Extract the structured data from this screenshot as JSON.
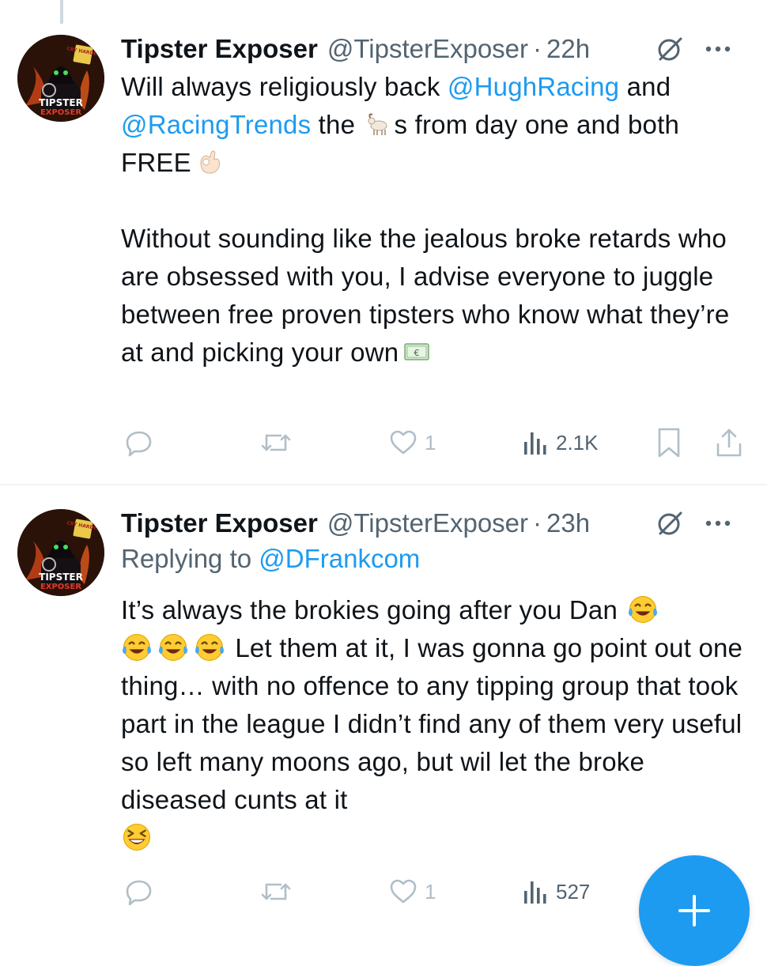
{
  "tweets": [
    {
      "display_name": "Tipster Exposer",
      "handle": "@TipsterExposer",
      "separator": "·",
      "time": "22h",
      "avatar": {
        "label_top": "TIPSTER",
        "label_bottom": "EXPOSER",
        "sign_text": "CRY HARDER"
      },
      "body": {
        "p1_seg1": "Will always religiously back ",
        "p1_mention1": "@HughRacing",
        "p1_seg2": " and ",
        "p1_mention2": "@RacingTrends",
        "p1_seg3": " the ",
        "p1_seg4": "s from day one and both FREE",
        "p2": "Without sounding like the jealous broke retards who are obsessed with you, I advise everyone to juggle between free proven tipsters who know what they’re at and picking your own"
      },
      "emojis": [
        "goat-emoji",
        "ok-hand-emoji",
        "euro-banknote-emoji"
      ],
      "actions": {
        "reply_count": "",
        "retweet_count": "",
        "like_count": "1",
        "view_count": "2.1K"
      }
    },
    {
      "display_name": "Tipster Exposer",
      "handle": "@TipsterExposer",
      "separator": "·",
      "time": "23h",
      "replying_label": "Replying to ",
      "replying_to": "@DFrankcom",
      "avatar": {
        "label_top": "TIPSTER",
        "label_bottom": "EXPOSER",
        "sign_text": "CRY HARDER"
      },
      "body": {
        "seg1": "It’s always the brokies going after you Dan",
        "seg2": "Let them at it, I was gonna go point out one thing… with no offence to any tipping group that took part in the league I didn’t find any of them very useful so left many moons ago, but wil let the broke diseased cunts at it"
      },
      "emojis": [
        "tears-of-joy-emoji",
        "tears-of-joy-emoji",
        "tears-of-joy-emoji",
        "tears-of-joy-emoji",
        "grinning-squinting-emoji"
      ],
      "actions": {
        "reply_count": "",
        "retweet_count": "",
        "like_count": "1",
        "view_count": "527"
      }
    }
  ],
  "icons": {
    "reply": "reply-icon",
    "retweet": "retweet-icon",
    "like": "heart-icon",
    "views": "views-icon",
    "bookmark": "bookmark-icon",
    "share": "share-icon",
    "grok": "grok-icon",
    "more": "more-icon",
    "compose": "plus-icon"
  },
  "colors": {
    "accent": "#1d9bf0",
    "text": "#0f1419",
    "muted": "#536471"
  }
}
